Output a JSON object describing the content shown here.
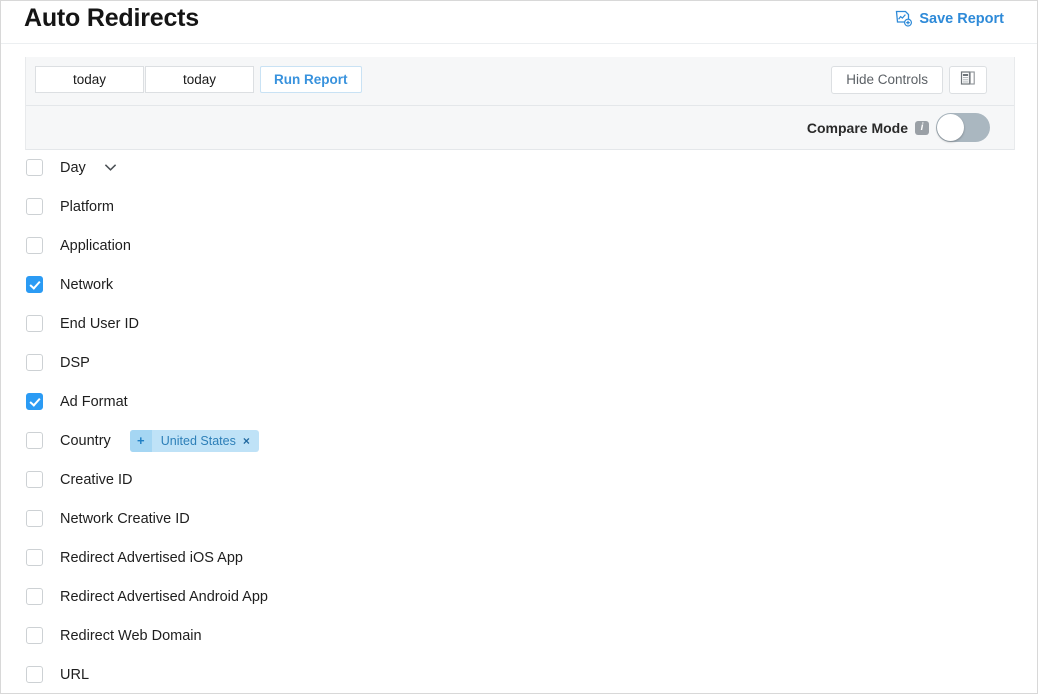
{
  "header": {
    "title": "Auto Redirects",
    "save_report_label": "Save Report",
    "save_report_icon": "report-plus-icon",
    "accent_color": "#2e8ad8"
  },
  "controls": {
    "date_start": "today",
    "date_end": "today",
    "date_placeholder": "today",
    "run_report_label": "Run Report",
    "hide_controls_label": "Hide Controls",
    "export_icon": "spreadsheet-export-icon",
    "compare_mode_label": "Compare Mode",
    "compare_mode_info_icon": "info-icon",
    "compare_mode_info_glyph": "i",
    "compare_mode_enabled": false,
    "panel_background": "#f6f7f8"
  },
  "dimensions": {
    "checked_color": "#2b9bf4",
    "items": [
      {
        "label": "Day",
        "checked": false,
        "has_chevron": true,
        "chevron_icon": "chevron-down-icon"
      },
      {
        "label": "Platform",
        "checked": false,
        "has_chevron": false
      },
      {
        "label": "Application",
        "checked": false,
        "has_chevron": false
      },
      {
        "label": "Network",
        "checked": true,
        "has_chevron": false
      },
      {
        "label": "End User ID",
        "checked": false,
        "has_chevron": false
      },
      {
        "label": "DSP",
        "checked": false,
        "has_chevron": false
      },
      {
        "label": "Ad Format",
        "checked": true,
        "has_chevron": false
      },
      {
        "label": "Country",
        "checked": false,
        "has_chevron": false
      },
      {
        "label": "Creative ID",
        "checked": false,
        "has_chevron": false
      },
      {
        "label": "Network Creative ID",
        "checked": false,
        "has_chevron": false
      },
      {
        "label": "Redirect Advertised iOS App",
        "checked": false,
        "has_chevron": false
      },
      {
        "label": "Redirect Advertised Android App",
        "checked": false,
        "has_chevron": false
      },
      {
        "label": "Redirect Web Domain",
        "checked": false,
        "has_chevron": false
      },
      {
        "label": "URL",
        "checked": false,
        "has_chevron": false
      }
    ]
  },
  "country_filter": {
    "add_label": "+",
    "value": "United States",
    "remove_label": "×",
    "tag_color": "#bfe2f7"
  }
}
